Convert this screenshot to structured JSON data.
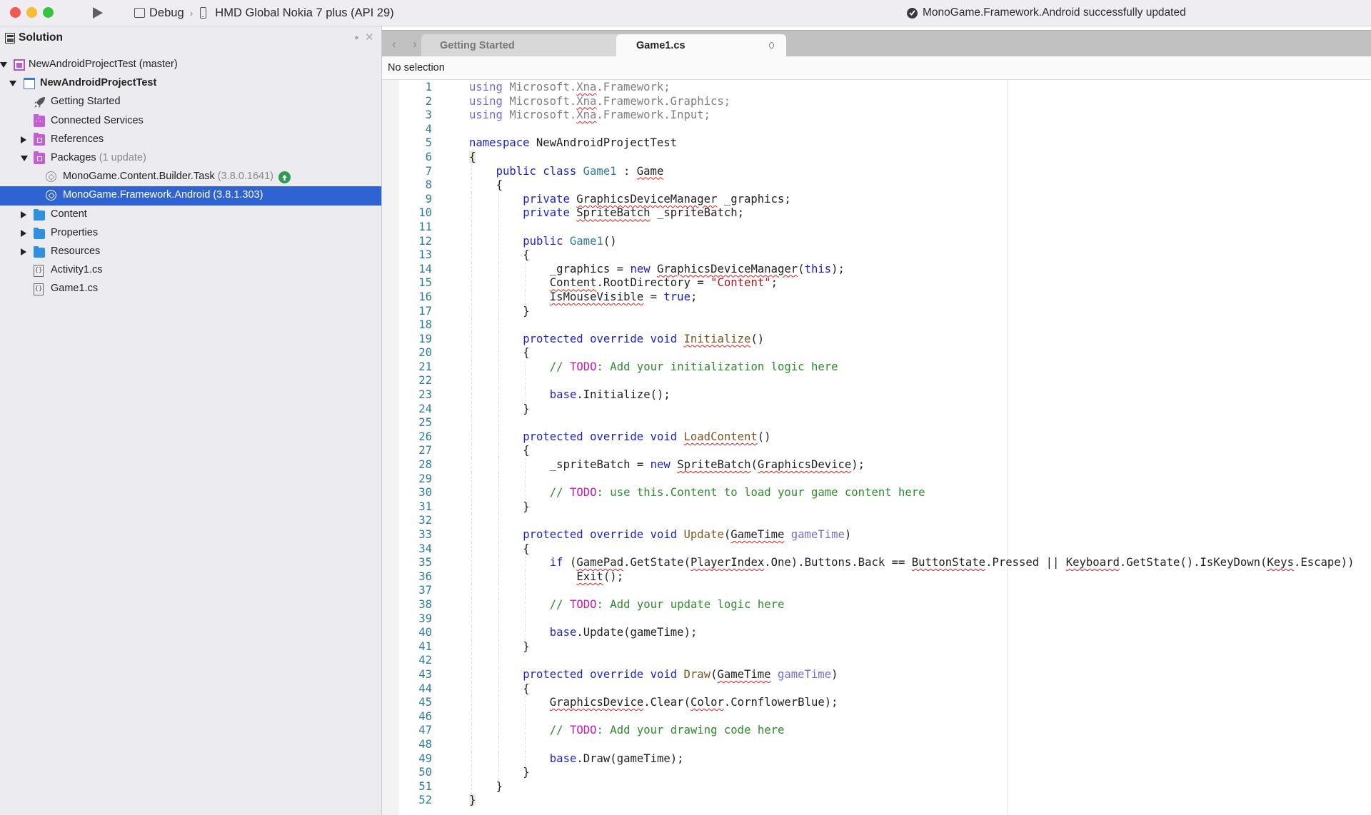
{
  "titlebar": {
    "run_label": "Run",
    "configuration": "Debug",
    "device": "HMD Global Nokia 7 plus (API 29)",
    "status_message": "MonoGame.Framework.Android successfully updated"
  },
  "sidebar": {
    "title": "Solution",
    "pin_glyph": "✈",
    "close_glyph": "✕",
    "nodes": [
      {
        "label": "NewAndroidProjectTest (master)",
        "muted": "",
        "level": 0,
        "arrow": "down",
        "icon": "solution-icon",
        "bold": false
      },
      {
        "label": "NewAndroidProjectTest",
        "muted": "",
        "level": 1,
        "arrow": "down",
        "icon": "project-icon",
        "bold": true
      },
      {
        "label": "Getting Started",
        "muted": "",
        "level": 2,
        "arrow": "",
        "icon": "rocket-icon",
        "bold": false
      },
      {
        "label": "Connected Services",
        "muted": "",
        "level": 2,
        "arrow": "",
        "icon": "connected-services-icon",
        "bold": false
      },
      {
        "label": "References",
        "muted": "",
        "level": 2,
        "arrow": "right",
        "icon": "references-folder-icon",
        "bold": false
      },
      {
        "label": "Packages",
        "muted": "(1 update)",
        "level": 2,
        "arrow": "down",
        "icon": "packages-folder-icon",
        "bold": false
      },
      {
        "label": "MonoGame.Content.Builder.Task",
        "muted": "(3.8.0.1641)",
        "level": 3,
        "arrow": "",
        "icon": "package-icon",
        "bold": false,
        "update_available": true
      },
      {
        "label": "MonoGame.Framework.Android (3.8.1.303)",
        "muted": "",
        "level": 3,
        "arrow": "",
        "icon": "package-icon",
        "bold": false,
        "selected": true
      },
      {
        "label": "Content",
        "muted": "",
        "level": 2,
        "arrow": "right",
        "icon": "folder-icon",
        "bold": false
      },
      {
        "label": "Properties",
        "muted": "",
        "level": 2,
        "arrow": "right",
        "icon": "folder-icon",
        "bold": false
      },
      {
        "label": "Resources",
        "muted": "",
        "level": 2,
        "arrow": "right",
        "icon": "folder-icon",
        "bold": false
      },
      {
        "label": "Activity1.cs",
        "muted": "",
        "level": 2,
        "arrow": "",
        "icon": "code-file-icon",
        "bold": false
      },
      {
        "label": "Game1.cs",
        "muted": "",
        "level": 2,
        "arrow": "",
        "icon": "code-file-icon",
        "bold": false
      }
    ]
  },
  "editor": {
    "nav_back": "‹",
    "nav_forward": "›",
    "tabs": [
      {
        "label": "Getting Started",
        "active": false
      },
      {
        "label": "Game1.cs",
        "active": true,
        "modified_indicator": "o"
      }
    ],
    "breadcrumb": "No selection",
    "colors": {
      "keyword": "#1d24c6",
      "type": "#2d7d95",
      "method": "#7a5522",
      "string": "#a3151a",
      "comment": "#2d8a2d",
      "todo": "#c31bb6",
      "error_underline": "#e41b1b",
      "line_number": "#2e7b96",
      "selection": "#2f63d3"
    },
    "code": [
      {
        "n": "1",
        "indent": 0,
        "t": [
          [
            "kw-dim",
            "using"
          ],
          [
            "dim",
            " Microsoft."
          ],
          [
            "dim err",
            "Xna"
          ],
          [
            "dim",
            ".Framework;"
          ]
        ]
      },
      {
        "n": "2",
        "indent": 0,
        "t": [
          [
            "kw-dim",
            "using"
          ],
          [
            "dim",
            " Microsoft."
          ],
          [
            "dim err",
            "Xna"
          ],
          [
            "dim",
            ".Framework.Graphics;"
          ]
        ]
      },
      {
        "n": "3",
        "indent": 0,
        "t": [
          [
            "kw-dim",
            "using"
          ],
          [
            "dim",
            " Microsoft."
          ],
          [
            "dim err",
            "Xna"
          ],
          [
            "dim",
            ".Framework.Input;"
          ]
        ]
      },
      {
        "n": "4",
        "indent": 0,
        "t": []
      },
      {
        "n": "5",
        "indent": 0,
        "t": [
          [
            "kw",
            "namespace"
          ],
          [
            "",
            " NewAndroidProjectTest"
          ]
        ]
      },
      {
        "n": "6",
        "indent": 0,
        "t": [
          [
            "brace-hl",
            "{"
          ]
        ]
      },
      {
        "n": "7",
        "indent": 1,
        "t": [
          [
            "kw",
            "public class "
          ],
          [
            "ty",
            "Game1"
          ],
          [
            "",
            " : "
          ],
          [
            "err",
            "Game"
          ]
        ]
      },
      {
        "n": "8",
        "indent": 1,
        "t": [
          [
            "",
            "{"
          ]
        ]
      },
      {
        "n": "9",
        "indent": 2,
        "t": [
          [
            "kw",
            "private "
          ],
          [
            "err",
            "GraphicsDeviceManager"
          ],
          [
            "",
            " _graphics;"
          ]
        ]
      },
      {
        "n": "10",
        "indent": 2,
        "t": [
          [
            "kw",
            "private "
          ],
          [
            "err",
            "SpriteBatch"
          ],
          [
            "",
            " _spriteBatch;"
          ]
        ]
      },
      {
        "n": "11",
        "indent": 2,
        "t": []
      },
      {
        "n": "12",
        "indent": 2,
        "t": [
          [
            "kw",
            "public "
          ],
          [
            "ty",
            "Game1"
          ],
          [
            "",
            "()"
          ]
        ]
      },
      {
        "n": "13",
        "indent": 2,
        "t": [
          [
            "",
            "{"
          ]
        ]
      },
      {
        "n": "14",
        "indent": 3,
        "t": [
          [
            "",
            "_graphics = "
          ],
          [
            "kw",
            "new "
          ],
          [
            "err",
            "GraphicsDeviceManager"
          ],
          [
            "",
            "("
          ],
          [
            "kw",
            "this"
          ],
          [
            "",
            ");"
          ]
        ]
      },
      {
        "n": "15",
        "indent": 3,
        "t": [
          [
            "err",
            "Content"
          ],
          [
            "",
            ".RootDirectory = "
          ],
          [
            "str",
            "\"Content\""
          ],
          [
            "",
            ";"
          ]
        ]
      },
      {
        "n": "16",
        "indent": 3,
        "t": [
          [
            "err",
            "IsMouseVisible"
          ],
          [
            "",
            " = "
          ],
          [
            "kw",
            "true"
          ],
          [
            "",
            ";"
          ]
        ]
      },
      {
        "n": "17",
        "indent": 2,
        "t": [
          [
            "",
            "}"
          ]
        ]
      },
      {
        "n": "18",
        "indent": 2,
        "t": []
      },
      {
        "n": "19",
        "indent": 2,
        "t": [
          [
            "kw",
            "protected override void "
          ],
          [
            "fn err",
            "Initialize"
          ],
          [
            "",
            "()"
          ]
        ]
      },
      {
        "n": "20",
        "indent": 2,
        "t": [
          [
            "",
            "{"
          ]
        ]
      },
      {
        "n": "21",
        "indent": 3,
        "t": [
          [
            "cm",
            "// "
          ],
          [
            "todo",
            "TODO"
          ],
          [
            "cm",
            ": Add your initialization logic here"
          ]
        ]
      },
      {
        "n": "22",
        "indent": 3,
        "t": []
      },
      {
        "n": "23",
        "indent": 3,
        "t": [
          [
            "kw",
            "base"
          ],
          [
            "",
            ".Initialize();"
          ]
        ]
      },
      {
        "n": "24",
        "indent": 2,
        "t": [
          [
            "",
            "}"
          ]
        ]
      },
      {
        "n": "25",
        "indent": 2,
        "t": []
      },
      {
        "n": "26",
        "indent": 2,
        "t": [
          [
            "kw",
            "protected override void "
          ],
          [
            "fn err",
            "LoadContent"
          ],
          [
            "",
            "()"
          ]
        ]
      },
      {
        "n": "27",
        "indent": 2,
        "t": [
          [
            "",
            "{"
          ]
        ]
      },
      {
        "n": "28",
        "indent": 3,
        "t": [
          [
            "",
            "_spriteBatch = "
          ],
          [
            "kw",
            "new "
          ],
          [
            "err",
            "SpriteBatch"
          ],
          [
            "",
            "("
          ],
          [
            "err",
            "GraphicsDevice"
          ],
          [
            "",
            ");"
          ]
        ]
      },
      {
        "n": "29",
        "indent": 3,
        "t": []
      },
      {
        "n": "30",
        "indent": 3,
        "t": [
          [
            "cm",
            "// "
          ],
          [
            "todo",
            "TODO"
          ],
          [
            "cm",
            ": use this.Content to load your game content here"
          ]
        ]
      },
      {
        "n": "31",
        "indent": 2,
        "t": [
          [
            "",
            "}"
          ]
        ]
      },
      {
        "n": "32",
        "indent": 2,
        "t": []
      },
      {
        "n": "33",
        "indent": 2,
        "t": [
          [
            "kw",
            "protected override void "
          ],
          [
            "fn",
            "Update"
          ],
          [
            "",
            "("
          ],
          [
            "err",
            "GameTime"
          ],
          [
            "",
            " "
          ],
          [
            "kw-dim",
            "gameTime"
          ],
          [
            "",
            ")"
          ]
        ]
      },
      {
        "n": "34",
        "indent": 2,
        "t": [
          [
            "",
            "{"
          ]
        ]
      },
      {
        "n": "35",
        "indent": 3,
        "t": [
          [
            "kw",
            "if"
          ],
          [
            "",
            " ("
          ],
          [
            "err",
            "GamePad"
          ],
          [
            "",
            ".GetState("
          ],
          [
            "err",
            "PlayerIndex"
          ],
          [
            "",
            ".One).Buttons.Back == "
          ],
          [
            "err",
            "ButtonState"
          ],
          [
            "",
            ".Pressed || "
          ],
          [
            "err",
            "Keyboard"
          ],
          [
            "",
            ".GetState().IsKeyDown("
          ],
          [
            "err",
            "Keys"
          ],
          [
            "",
            ".Escape))"
          ]
        ]
      },
      {
        "n": "36",
        "indent": 3,
        "t": [
          [
            "",
            "    "
          ],
          [
            "err",
            "Exit"
          ],
          [
            "",
            "();"
          ]
        ]
      },
      {
        "n": "37",
        "indent": 3,
        "t": []
      },
      {
        "n": "38",
        "indent": 3,
        "t": [
          [
            "cm",
            "// "
          ],
          [
            "todo",
            "TODO"
          ],
          [
            "cm",
            ": Add your update logic here"
          ]
        ]
      },
      {
        "n": "39",
        "indent": 3,
        "t": []
      },
      {
        "n": "40",
        "indent": 3,
        "t": [
          [
            "kw",
            "base"
          ],
          [
            "",
            ".Update(gameTime);"
          ]
        ]
      },
      {
        "n": "41",
        "indent": 2,
        "t": [
          [
            "",
            "}"
          ]
        ]
      },
      {
        "n": "42",
        "indent": 2,
        "t": []
      },
      {
        "n": "43",
        "indent": 2,
        "t": [
          [
            "kw",
            "protected override void "
          ],
          [
            "fn",
            "Draw"
          ],
          [
            "",
            "("
          ],
          [
            "err",
            "GameTime"
          ],
          [
            "",
            " "
          ],
          [
            "kw-dim",
            "gameTime"
          ],
          [
            "",
            ")"
          ]
        ]
      },
      {
        "n": "44",
        "indent": 2,
        "t": [
          [
            "",
            "{"
          ]
        ]
      },
      {
        "n": "45",
        "indent": 3,
        "t": [
          [
            "err",
            "GraphicsDevice"
          ],
          [
            "",
            ".Clear("
          ],
          [
            "err",
            "Color"
          ],
          [
            "",
            ".CornflowerBlue);"
          ]
        ]
      },
      {
        "n": "46",
        "indent": 3,
        "t": []
      },
      {
        "n": "47",
        "indent": 3,
        "t": [
          [
            "cm",
            "// "
          ],
          [
            "todo",
            "TODO"
          ],
          [
            "cm",
            ": Add your drawing code here"
          ]
        ]
      },
      {
        "n": "48",
        "indent": 3,
        "t": []
      },
      {
        "n": "49",
        "indent": 3,
        "t": [
          [
            "kw",
            "base"
          ],
          [
            "",
            ".Draw(gameTime);"
          ]
        ]
      },
      {
        "n": "50",
        "indent": 2,
        "t": [
          [
            "",
            "}"
          ]
        ]
      },
      {
        "n": "51",
        "indent": 1,
        "t": [
          [
            "",
            "}"
          ]
        ]
      },
      {
        "n": "52",
        "indent": 0,
        "t": [
          [
            "brace-hl",
            "}"
          ]
        ]
      }
    ]
  }
}
